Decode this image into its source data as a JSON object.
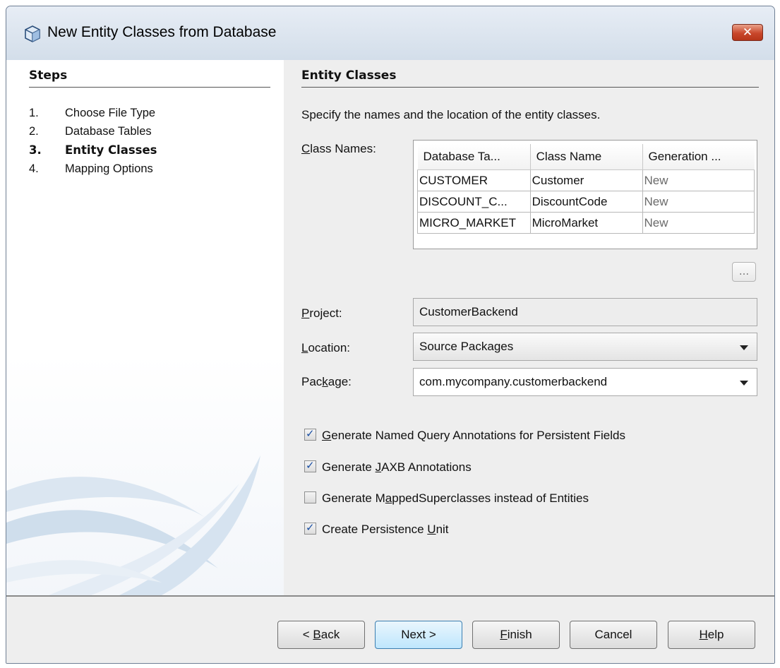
{
  "window": {
    "title": "New Entity Classes from Database",
    "close_symbol": "✕"
  },
  "steps": {
    "heading": "Steps",
    "items": [
      {
        "num": "1.",
        "label": "Choose File Type"
      },
      {
        "num": "2.",
        "label": "Database Tables"
      },
      {
        "num": "3.",
        "label": "Entity Classes",
        "current": true
      },
      {
        "num": "4.",
        "label": "Mapping Options"
      }
    ]
  },
  "content": {
    "heading": "Entity Classes",
    "description": "Specify the names and the location of the entity classes.",
    "class_names_label": {
      "mnemonic": "C",
      "rest": "lass Names:"
    },
    "table": {
      "columns": [
        "Database Ta...",
        "Class Name",
        "Generation ..."
      ],
      "rows": [
        [
          "CUSTOMER",
          "Customer",
          "New"
        ],
        [
          "DISCOUNT_C...",
          "DiscountCode",
          "New"
        ],
        [
          "MICRO_MARKET",
          "MicroMarket",
          "New"
        ]
      ]
    },
    "ellipsis_button": "...",
    "project": {
      "label_mnemonic": "P",
      "label_rest": "roject:",
      "value": "CustomerBackend"
    },
    "location": {
      "label_mnemonic": "L",
      "label_rest": "ocation:",
      "value": "Source Packages"
    },
    "package": {
      "label_pre": "Pac",
      "label_mnemonic": "k",
      "label_rest": "age:",
      "value": "com.mycompany.customerbackend"
    },
    "options": [
      {
        "pre": "",
        "mnemonic": "G",
        "rest": "enerate Named Query Annotations for Persistent Fields",
        "checked": true
      },
      {
        "pre": "Generate ",
        "mnemonic": "J",
        "rest": "AXB Annotations",
        "checked": true
      },
      {
        "pre": "Generate M",
        "mnemonic": "a",
        "rest": "ppedSuperclasses instead of Entities",
        "checked": false
      },
      {
        "pre": "Create Persistence ",
        "mnemonic": "U",
        "rest": "nit",
        "checked": true
      }
    ]
  },
  "buttons": {
    "back": {
      "pre": "< ",
      "mnemonic": "B",
      "rest": "ack"
    },
    "next": "Next >",
    "finish": {
      "mnemonic": "F",
      "rest": "inish"
    },
    "cancel": "Cancel",
    "help": {
      "mnemonic": "H",
      "rest": "elp"
    }
  },
  "colors": {
    "title_bar": "#d3deea",
    "close_button": "#c9472b",
    "default_button": "#bee6fd",
    "checkbox_check": "#1a4fa3"
  }
}
